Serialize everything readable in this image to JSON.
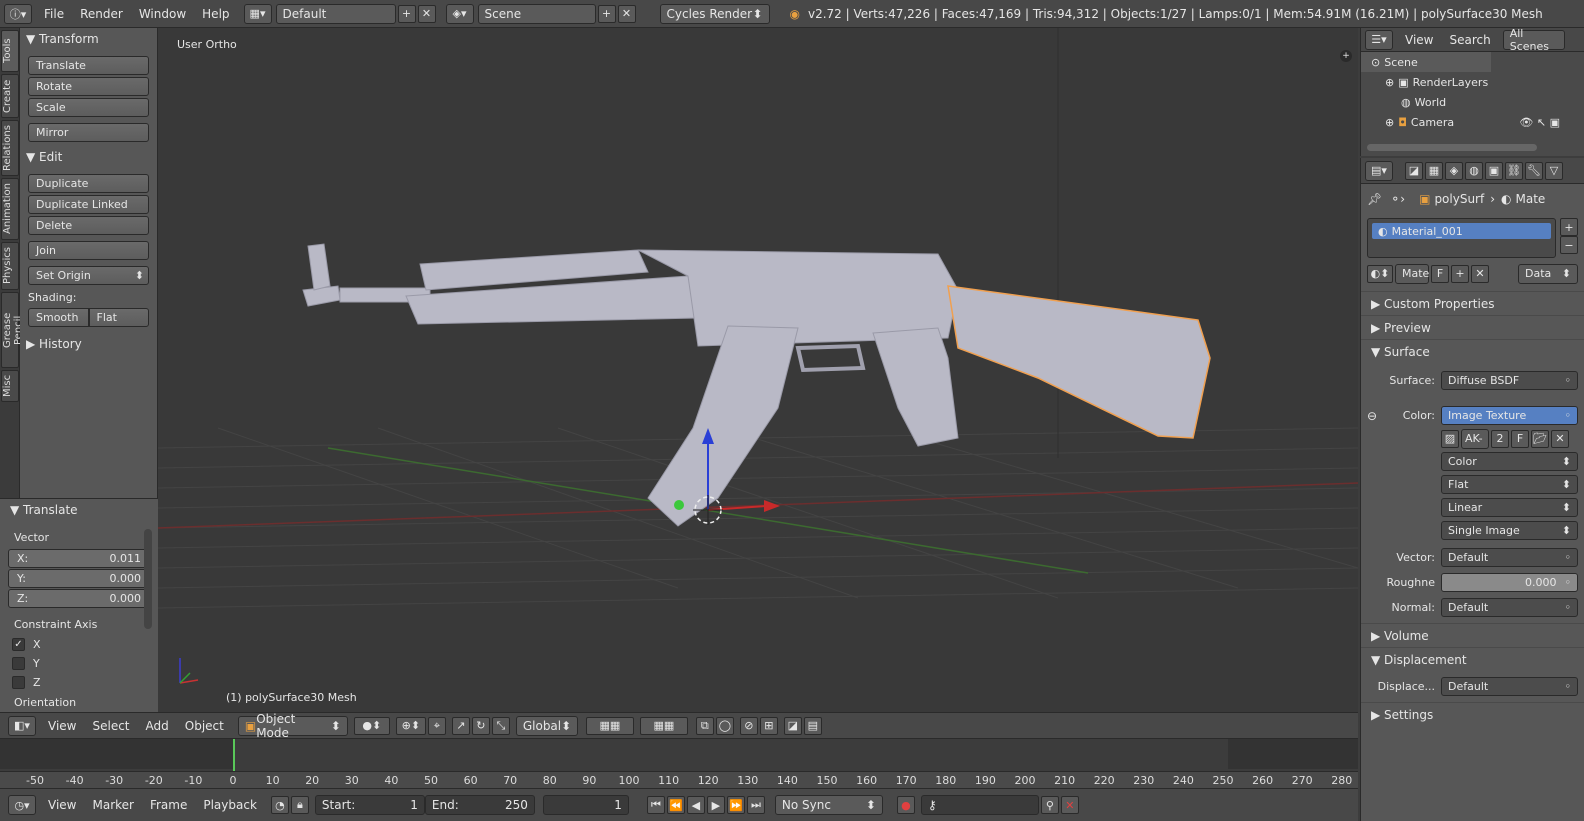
{
  "topbar": {
    "menus": [
      "File",
      "Render",
      "Window",
      "Help"
    ],
    "layout": "Default",
    "scene": "Scene",
    "engine": "Cycles Render",
    "stats": "v2.72 | Verts:47,226 | Faces:47,169 | Tris:94,312 | Objects:1/27 | Lamps:0/1 | Mem:54.91M (16.21M) | polySurface30 Mesh"
  },
  "tabs": [
    "Tools",
    "Create",
    "Relations",
    "Animation",
    "Physics",
    "Grease Pencil",
    "Misc"
  ],
  "toolshelf": {
    "transform_header": "Transform",
    "translate": "Translate",
    "rotate": "Rotate",
    "scale": "Scale",
    "mirror": "Mirror",
    "edit_header": "Edit",
    "duplicate": "Duplicate",
    "duplicate_linked": "Duplicate Linked",
    "delete": "Delete",
    "join": "Join",
    "set_origin": "Set Origin",
    "shading_label": "Shading:",
    "smooth": "Smooth",
    "flat": "Flat",
    "history_header": "History"
  },
  "operator": {
    "header": "Translate",
    "vector_label": "Vector",
    "x_label": "X:",
    "x_value": "0.011",
    "y_label": "Y:",
    "y_value": "0.000",
    "z_label": "Z:",
    "z_value": "0.000",
    "constraint_label": "Constraint Axis",
    "axis_x": "X",
    "axis_y": "Y",
    "axis_z": "Z",
    "orientation_label": "Orientation"
  },
  "viewport": {
    "view_name": "User Ortho",
    "object_info": "(1) polySurface30 Mesh"
  },
  "vphdr": {
    "menus": [
      "View",
      "Select",
      "Add",
      "Object"
    ],
    "mode": "Object Mode",
    "orientation": "Global"
  },
  "timeline": {
    "ticks": [
      "-50",
      "-40",
      "-30",
      "-20",
      "-10",
      "0",
      "10",
      "20",
      "30",
      "40",
      "50",
      "60",
      "70",
      "80",
      "90",
      "100",
      "110",
      "120",
      "130",
      "140",
      "150",
      "160",
      "170",
      "180",
      "190",
      "200",
      "210",
      "220",
      "230",
      "240",
      "250",
      "260",
      "270",
      "280"
    ],
    "menus": [
      "View",
      "Marker",
      "Frame",
      "Playback"
    ],
    "start_label": "Start:",
    "start_value": "1",
    "end_label": "End:",
    "end_value": "250",
    "current_frame": "1",
    "sync": "No Sync"
  },
  "outliner": {
    "menus": [
      "View",
      "Search"
    ],
    "filter": "All Scenes",
    "items": [
      "Scene",
      "RenderLayers",
      "World",
      "Camera"
    ]
  },
  "properties": {
    "breadcrumb_obj": "polySurf",
    "breadcrumb_mat": "Mate",
    "material_slot": "Material_001",
    "mat_name": "Mate",
    "mat_f": "F",
    "link": "Data",
    "custom_props": "Custom Properties",
    "preview": "Preview",
    "surface_header": "Surface",
    "surface_label": "Surface:",
    "surface_value": "Diffuse BSDF",
    "color_label": "Color:",
    "color_value": "Image Texture",
    "img_name": "AK-",
    "img_users": "2",
    "img_f": "F",
    "colorspace": "Color",
    "projection": "Flat",
    "interp": "Linear",
    "source": "Single Image",
    "vector_label": "Vector:",
    "vector_value": "Default",
    "rough_label": "Roughne",
    "rough_value": "0.000",
    "normal_label": "Normal:",
    "normal_value": "Default",
    "volume": "Volume",
    "displacement_header": "Displacement",
    "displace_label": "Displace...",
    "displace_value": "Default",
    "settings": "Settings"
  },
  "colors": {
    "selected_outline": "#f0a050",
    "axis_x": "#b23a3a",
    "axis_y": "#4a8a3a",
    "highlight": "#5680c2"
  }
}
